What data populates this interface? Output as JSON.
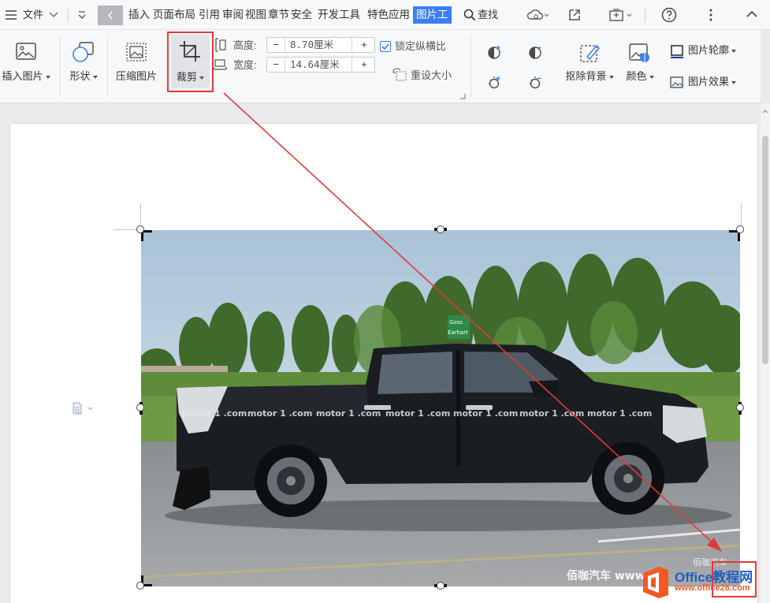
{
  "menu": {
    "file_label": "文件",
    "tabs": [
      "插入",
      "页面布局",
      "引用",
      "审阅",
      "视图",
      "章节",
      "安全",
      "开发工具",
      "特色应用"
    ],
    "active_tab": "图片工",
    "search_label": "查找"
  },
  "ribbon": {
    "insert_picture": "插入图片",
    "shape": "形状",
    "compress": "压缩图片",
    "crop": "裁剪",
    "height_label": "高度:",
    "height_value": "8.70厘米",
    "width_label": "宽度:",
    "width_value": "14.64厘米",
    "lock_ratio": "锁定纵横比",
    "lock_ratio_checked": true,
    "reset_size": "重设大小",
    "remove_bg": "抠除背景",
    "color": "颜色",
    "outline": "图片轮廓",
    "effect": "图片效果",
    "minus": "−",
    "plus": "+"
  },
  "image": {
    "description_icon": "car-photo",
    "watermark_text": "佰咖汽车 www",
    "watermark_corner": "佰咖汽车",
    "motor_labels": [
      "motor 1 .com",
      "motor 1 .com",
      "motor 1 .com",
      "motor 1 .com",
      "motor 1 .com",
      "motor 1 .com",
      "motor 1 .com"
    ],
    "road_sign": [
      "Goss",
      "Earhart"
    ]
  },
  "logo": {
    "brand": "Office教程网",
    "url": "www.office26.com"
  },
  "colors": {
    "accent": "#3c7ef4",
    "highlight": "#e03a3a",
    "brand_orange": "#f25a22",
    "brand_blue": "#1f5fbf"
  }
}
